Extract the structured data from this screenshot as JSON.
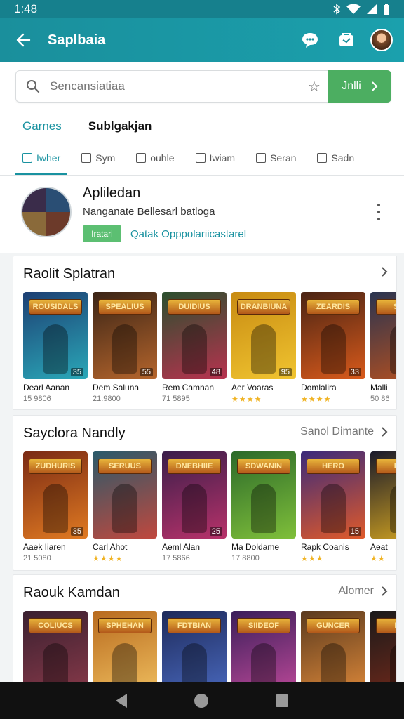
{
  "status_bar": {
    "time": "1:48"
  },
  "app_bar": {
    "title": "Saplbaia"
  },
  "search": {
    "placeholder": "Sencansiatiaa",
    "button_label": "Jnlli"
  },
  "top_tabs": [
    "Garnes",
    "Sublgakjan"
  ],
  "chips": [
    "Iwher",
    "Sym",
    "ouhle",
    "Iwiam",
    "Seran",
    "Sadn"
  ],
  "profile": {
    "name": "Apliledan",
    "description": "Nanganate Bellesarl batloga",
    "badge": "Iratari",
    "link": "Qatak Opppolariicastarel"
  },
  "sections": [
    {
      "title": "Raolit Splatran",
      "more_label": "",
      "cards": [
        {
          "banner": "ROUSIDALS",
          "title": "Dearl Aanan",
          "sub": "15 9806",
          "stars": "",
          "rating": "35",
          "colors": [
            "#1d3f73",
            "#2aa8b8"
          ]
        },
        {
          "banner": "SPEALIUS",
          "title": "Dem Saluna",
          "sub": "21.9800",
          "stars": "",
          "rating": "55",
          "colors": [
            "#3a2416",
            "#b5652c"
          ]
        },
        {
          "banner": "DUIDIUS",
          "title": "Rem Camnan",
          "sub": "71 5895",
          "stars": "",
          "rating": "48",
          "colors": [
            "#2b4f2e",
            "#b8324f"
          ]
        },
        {
          "banner": "DRANBIUNA",
          "title": "Aer Voaras",
          "sub": "",
          "stars": "★★★★",
          "rating": "95",
          "colors": [
            "#c88b12",
            "#f0c430"
          ]
        },
        {
          "banner": "ZEARDIS",
          "title": "Domlalira",
          "sub": "",
          "stars": "★★★★",
          "rating": "33",
          "colors": [
            "#4a2414",
            "#d95a1b"
          ]
        },
        {
          "banner": "SIDE",
          "title": "Malli",
          "sub": "50 86",
          "stars": "",
          "rating": "",
          "colors": [
            "#2a3450",
            "#b6501f"
          ]
        }
      ]
    },
    {
      "title": "Sayclora Nandly",
      "more_label": "Sanol Dimante",
      "cards": [
        {
          "banner": "ZUDHURIS",
          "title": "Aaek Iiaren",
          "sub": "21 5080",
          "stars": "",
          "rating": "35",
          "colors": [
            "#7a2a14",
            "#e07a22"
          ]
        },
        {
          "banner": "SERUUS",
          "title": "Carl Ahot",
          "sub": "",
          "stars": "★★★★",
          "rating": "",
          "colors": [
            "#2a5a6a",
            "#c0483e"
          ]
        },
        {
          "banner": "DNEBHIIE",
          "title": "Aeml Alan",
          "sub": "17 5866",
          "stars": "",
          "rating": "25",
          "colors": [
            "#3a1e4a",
            "#b8326a"
          ]
        },
        {
          "banner": "SDWANIN",
          "title": "Ma Doldame",
          "sub": "17 8800",
          "stars": "",
          "rating": "",
          "colors": [
            "#2c6a2a",
            "#7fbf3a"
          ]
        },
        {
          "banner": "HERO",
          "title": "Rapk Coanis",
          "sub": "",
          "stars": "★★★",
          "rating": "15",
          "colors": [
            "#3b2a7a",
            "#e05a2a"
          ]
        },
        {
          "banner": "BOR",
          "title": "Aeat",
          "sub": "",
          "stars": "★★",
          "rating": "",
          "colors": [
            "#1a1a2a",
            "#d4a520"
          ]
        }
      ]
    },
    {
      "title": "Raouk Kamdan",
      "more_label": "Alomer",
      "cards": [
        {
          "banner": "COLIUCS",
          "title": "",
          "sub": "",
          "stars": "",
          "rating": "",
          "colors": [
            "#3a2030",
            "#8a3a4a"
          ]
        },
        {
          "banner": "SPHEHAN",
          "title": "",
          "sub": "",
          "stars": "",
          "rating": "",
          "colors": [
            "#b86a1e",
            "#f0c060"
          ]
        },
        {
          "banner": "FDTBIAN",
          "title": "",
          "sub": "",
          "stars": "",
          "rating": "",
          "colors": [
            "#1e2a5a",
            "#4a6ac0"
          ]
        },
        {
          "banner": "SIIDEOF",
          "title": "",
          "sub": "",
          "stars": "",
          "rating": "",
          "colors": [
            "#3a1e5a",
            "#c04a9a"
          ]
        },
        {
          "banner": "GUNCER",
          "title": "",
          "sub": "",
          "stars": "",
          "rating": "",
          "colors": [
            "#5a3a1e",
            "#e08a3a"
          ]
        },
        {
          "banner": "BED",
          "title": "",
          "sub": "",
          "stars": "",
          "rating": "",
          "colors": [
            "#1a1a1a",
            "#7a2a1a"
          ]
        }
      ]
    }
  ],
  "colors": {
    "primary": "#1a8f9c",
    "accent_green": "#4cae61",
    "link": "#1992a0"
  }
}
